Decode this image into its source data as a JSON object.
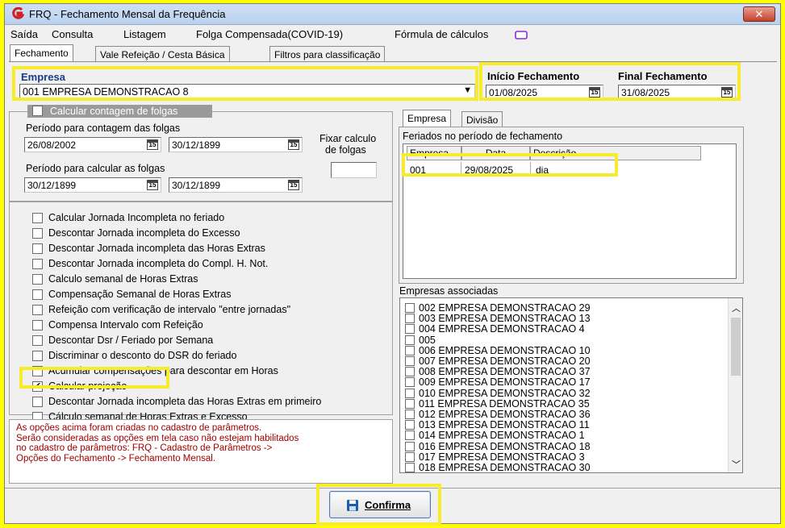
{
  "window": {
    "title": "FRQ - Fechamento Mensal da Frequência",
    "close_label": "✕"
  },
  "menu": [
    "Saída",
    "Consulta",
    "Listagem",
    "Folga Compensada(COVID-19)",
    "Fórmula de cálculos"
  ],
  "tabs": [
    "Fechamento",
    "Vale Refeição / Cesta Básica",
    "Filtros para classificação"
  ],
  "empresa": {
    "label": "Empresa",
    "value": "001 EMPRESA DEMONSTRACAO 8"
  },
  "inicio": {
    "label": "Início Fechamento",
    "value": "01/08/2025"
  },
  "final": {
    "label": "Final Fechamento",
    "value": "31/08/2025"
  },
  "cal_glyph": "15",
  "folgas": {
    "toggle_label": "Calcular contagem de folgas",
    "periodo_contagem_label": "Período para contagem das folgas",
    "contagem_de": "26/08/2002",
    "contagem_ate": "30/12/1899",
    "periodo_calcular_label": "Período para calcular as folgas",
    "calcular_de": "30/12/1899",
    "calcular_ate": "30/12/1899",
    "fixar_label_1": "Fixar calculo",
    "fixar_label_2": "de folgas",
    "fixar_value": ""
  },
  "options": [
    {
      "label": "Calcular Jornada Incompleta no feriado",
      "checked": false
    },
    {
      "label": "Descontar Jornada incompleta do Excesso",
      "checked": false
    },
    {
      "label": "Descontar Jornada incompleta das Horas Extras",
      "checked": false
    },
    {
      "label": "Descontar Jornada incompleta do Compl. H. Not.",
      "checked": false
    },
    {
      "label": "Calculo semanal de Horas Extras",
      "checked": false
    },
    {
      "label": "Compensação Semanal de Horas Extras",
      "checked": false
    },
    {
      "label": "Refeição com verificação de intervalo  \"entre jornadas\"",
      "checked": false
    },
    {
      "label": "Compensa Intervalo com Refeição",
      "checked": false
    },
    {
      "label": "Descontar Dsr / Feriado por Semana",
      "checked": false
    },
    {
      "label": "Discriminar o desconto do DSR do feriado",
      "checked": false
    },
    {
      "label": "Acumular compensações para descontar em Horas",
      "checked": false
    },
    {
      "label": "Calcular projeção",
      "checked": true
    },
    {
      "label": "Descontar Jornada incompleta das Horas Extras em primeiro",
      "checked": false
    },
    {
      "label": "Cálculo semanal de Horas Extras e Excesso",
      "checked": false
    }
  ],
  "check_glyph": "✔",
  "notes": "As opções acima foram criadas no cadastro de parâmetros.\nSerão consideradas as opções em tela caso não estejam habilitados\nno cadastro de parâmetros: FRQ - Cadastro de Parâmetros ->\nOpções do Fechamento -> Fechamento Mensal.",
  "subtabs": [
    "Empresa",
    "Divisão"
  ],
  "feriados": {
    "label": "Feriados no período de fechamento",
    "columns": [
      "Empresa",
      "Data",
      "Descrição"
    ],
    "rows": [
      {
        "empresa": "001",
        "data": "29/08/2025",
        "descricao": "dia"
      }
    ]
  },
  "associadas": {
    "label": "Empresas associadas",
    "items": [
      "002 EMPRESA DEMONSTRACAO 29",
      "003 EMPRESA DEMONSTRACAO 13",
      "004 EMPRESA DEMONSTRACAO 4",
      "005",
      "006 EMPRESA DEMONSTRACAO 10",
      "007 EMPRESA DEMONSTRACAO 20",
      "008 EMPRESA DEMONSTRACAO 37",
      "009 EMPRESA DEMONSTRACAO 17",
      "010 EMPRESA DEMONSTRACAO 32",
      "011 EMPRESA DEMONSTRACAO 35",
      "012 EMPRESA DEMONSTRACAO 36",
      "013 EMPRESA DEMONSTRACAO 11",
      "014 EMPRESA DEMONSTRACAO 1",
      "016 EMPRESA DEMONSTRACAO 18",
      "017 EMPRESA DEMONSTRACAO 3",
      "018 EMPRESA DEMONSTRACAO 30"
    ]
  },
  "confirm_label": "Confirma",
  "colors": {
    "highlight": "#f6ec2b",
    "notes": "#a00000",
    "accent": "#1a5fb4"
  }
}
